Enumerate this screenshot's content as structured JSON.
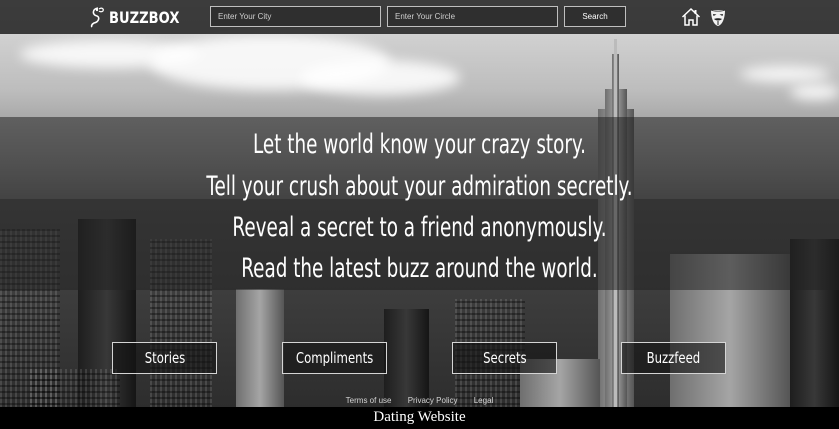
{
  "header": {
    "logo_text": "BUZZBOX",
    "city_placeholder": "Enter Your City",
    "circle_placeholder": "Enter Your Circle",
    "search_label": "Search",
    "icons": [
      "home-icon",
      "guy-fawkes-mask-icon"
    ]
  },
  "hero": {
    "taglines": [
      "Let the world know your crazy story.",
      "Tell your crush about your admiration secretly.",
      "Reveal a secret to a friend anonymously.",
      "Read the latest buzz around the world."
    ]
  },
  "categories": [
    {
      "label": "Stories"
    },
    {
      "label": "Compliments"
    },
    {
      "label": "Secrets"
    },
    {
      "label": "Buzzfeed"
    }
  ],
  "footer": {
    "links": [
      "Terms of use",
      "Privacy Policy",
      "Legal"
    ]
  },
  "caption": "Dating Website",
  "colors": {
    "header_bg": "#1e1e1e",
    "text": "#ffffff",
    "caption_bg": "#000000"
  }
}
